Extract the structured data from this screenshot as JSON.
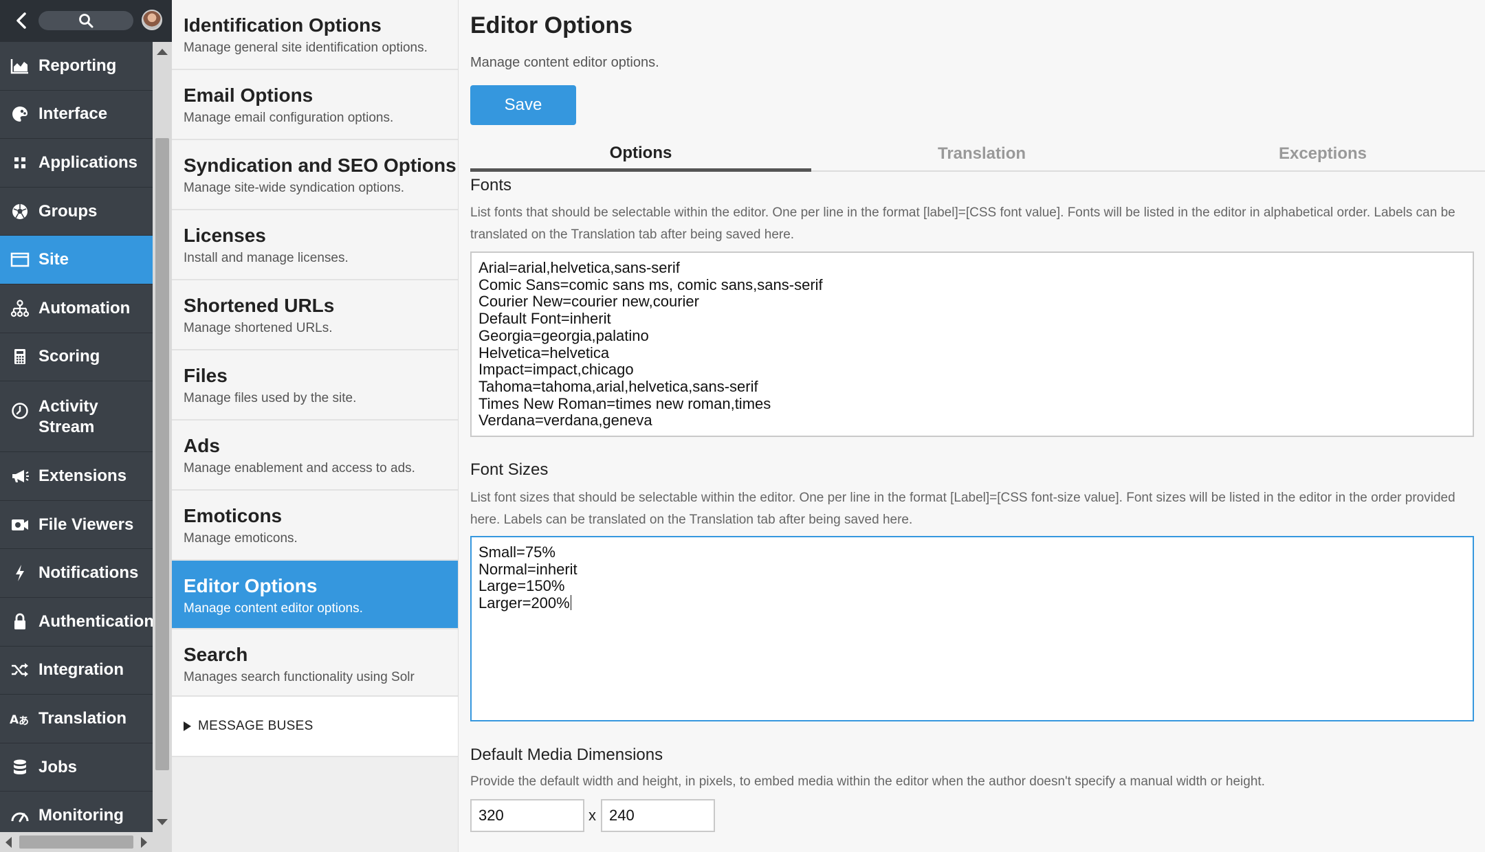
{
  "nav": {
    "items": [
      {
        "label": "Reporting",
        "icon": "area-chart-icon"
      },
      {
        "label": "Interface",
        "icon": "palette-icon"
      },
      {
        "label": "Applications",
        "icon": "grid-icon"
      },
      {
        "label": "Groups",
        "icon": "soccer-ball-icon"
      },
      {
        "label": "Site",
        "icon": "browser-window-icon"
      },
      {
        "label": "Automation",
        "icon": "org-chart-icon"
      },
      {
        "label": "Scoring",
        "icon": "calculator-icon"
      },
      {
        "label": "Activity Stream",
        "icon": "clock-icon"
      },
      {
        "label": "Extensions",
        "icon": "megaphone-icon"
      },
      {
        "label": "File Viewers",
        "icon": "video-camera-icon"
      },
      {
        "label": "Notifications",
        "icon": "lightning-icon"
      },
      {
        "label": "Authentication",
        "icon": "lock-icon"
      },
      {
        "label": "Integration",
        "icon": "shuffle-icon"
      },
      {
        "label": "Translation",
        "icon": "translate-icon"
      },
      {
        "label": "Jobs",
        "icon": "database-icon"
      },
      {
        "label": "Monitoring",
        "icon": "gauge-icon"
      }
    ],
    "active": "Site"
  },
  "settings": {
    "items": [
      {
        "title": "Identification Options",
        "desc": "Manage general site identification options."
      },
      {
        "title": "Email Options",
        "desc": "Manage email configuration options."
      },
      {
        "title": "Syndication and SEO Options",
        "desc": "Manage site-wide syndication options."
      },
      {
        "title": "Licenses",
        "desc": "Install and manage licenses."
      },
      {
        "title": "Shortened URLs",
        "desc": "Manage shortened URLs."
      },
      {
        "title": "Files",
        "desc": "Manage files used by the site."
      },
      {
        "title": "Ads",
        "desc": "Manage enablement and access to ads."
      },
      {
        "title": "Emoticons",
        "desc": "Manage emoticons."
      },
      {
        "title": "Editor Options",
        "desc": "Manage content editor options."
      },
      {
        "title": "Search",
        "desc": "Manages search functionality using Solr"
      }
    ],
    "message_buses": "MESSAGE BUSES"
  },
  "main": {
    "title": "Editor Options",
    "desc": "Manage content editor options.",
    "save_label": "Save",
    "tabs": [
      "Options",
      "Translation",
      "Exceptions"
    ],
    "fonts": {
      "title": "Fonts",
      "desc": "List fonts that should be selectable within the editor. One per line in the format [label]=[CSS font value]. Fonts will be listed in the editor in alphabetical order. Labels can be translated on the Translation tab after being saved here.",
      "lines": [
        "Arial=arial,helvetica,sans-serif",
        "Comic Sans=comic sans ms, comic sans,sans-serif",
        "Courier New=courier new,courier",
        "Default Font=inherit",
        "Georgia=georgia,palatino",
        "Helvetica=helvetica",
        "Impact=impact,chicago",
        "Tahoma=tahoma,arial,helvetica,sans-serif",
        "Times New Roman=times new roman,times",
        "Verdana=verdana,geneva"
      ]
    },
    "font_sizes": {
      "title": "Font Sizes",
      "desc": "List font sizes that should be selectable within the editor. One per line in the format [Label]=[CSS font-size value]. Font sizes will be listed in the editor in the order provided here. Labels can be translated on the Translation tab after being saved here.",
      "lines": [
        "Small=75%",
        "Normal=inherit",
        "Large=150%",
        "Larger=200%"
      ]
    },
    "media": {
      "title": "Default Media Dimensions",
      "desc": "Provide the default width and height, in pixels, to embed media within the editor when the author doesn't specify a manual width or height.",
      "width": "320",
      "separator": "x",
      "height": "240"
    }
  },
  "colors": {
    "accent": "#3597de",
    "nav_bg": "#3b4148",
    "nav_top": "#2b3036"
  }
}
